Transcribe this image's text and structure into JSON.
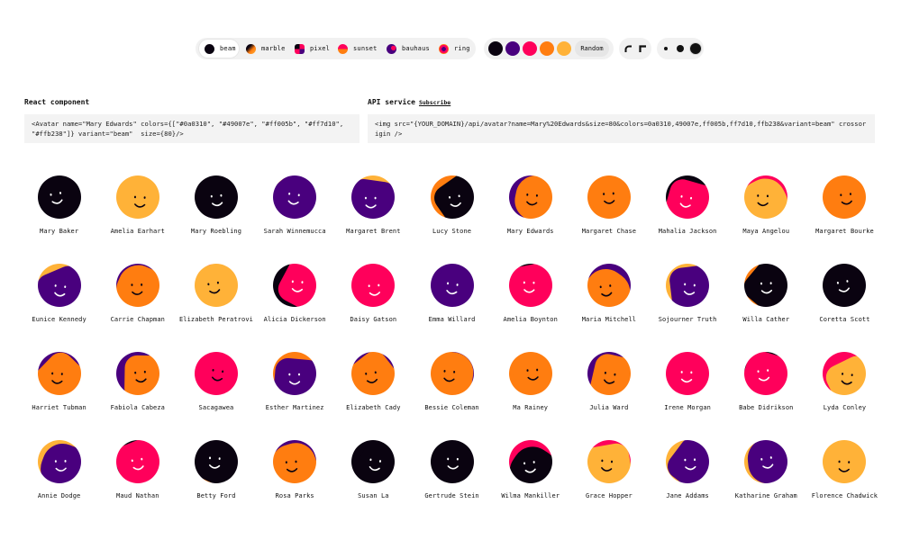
{
  "toolbar": {
    "variants": [
      {
        "label": "beam",
        "active": true,
        "icon": "beam-icon"
      },
      {
        "label": "marble",
        "active": false,
        "icon": "marble-icon"
      },
      {
        "label": "pixel",
        "active": false,
        "icon": "pixel-icon"
      },
      {
        "label": "sunset",
        "active": false,
        "icon": "sunset-icon"
      },
      {
        "label": "bauhaus",
        "active": false,
        "icon": "bauhaus-icon"
      },
      {
        "label": "ring",
        "active": false,
        "icon": "ring-icon"
      }
    ],
    "palette": [
      "#0a0310",
      "#49007e",
      "#ff005b",
      "#ff7d10",
      "#ffb238"
    ],
    "random_label": "Random",
    "shapes": [
      {
        "name": "round-shape-icon"
      },
      {
        "name": "square-shape-icon"
      }
    ],
    "sizes": [
      {
        "name": "size-small-button"
      },
      {
        "name": "size-medium-button"
      },
      {
        "name": "size-large-button"
      }
    ]
  },
  "code": {
    "react_label": "React component",
    "react_code": "<Avatar name=\"Mary Edwards\" colors={[\"#0a0310\", \"#49007e\", \"#ff005b\", \"#ff7d10\", \"#ffb238\"]} variant=\"beam\"  size={80}/>",
    "api_label": "API service",
    "subscribe_label": "Subscribe",
    "api_code": "<img src=\"{YOUR_DOMAIN}/api/avatar?name=Mary%20Edwards&size=80&colors=0a0310,49007e,ff005b,ff7d10,ffb238&variant=beam\" crossorigin />"
  },
  "avatars": [
    {
      "name": "Mary Baker",
      "bg": "#ff7d10",
      "face": "#0a0310",
      "eyes": "#ffffff"
    },
    {
      "name": "Amelia Earhart",
      "bg": "#ffb238",
      "face": "#ffb238",
      "eyes": "#0a0310"
    },
    {
      "name": "Mary Roebling",
      "bg": "#0a0310",
      "face": "#0a0310",
      "eyes": "#ffffff"
    },
    {
      "name": "Sarah Winnemucca",
      "bg": "#ffb238",
      "face": "#49007e",
      "eyes": "#ffffff"
    },
    {
      "name": "Margaret Brent",
      "bg": "#ffb238",
      "face": "#49007e",
      "eyes": "#ffffff"
    },
    {
      "name": "Lucy Stone",
      "bg": "#ff7d10",
      "face": "#0a0310",
      "eyes": "#ffffff"
    },
    {
      "name": "Mary Edwards",
      "bg": "#49007e",
      "face": "#ff7d10",
      "eyes": "#0a0310"
    },
    {
      "name": "Margaret Chase",
      "bg": "#ff7d10",
      "face": "#ff7d10",
      "eyes": "#0a0310"
    },
    {
      "name": "Mahalia Jackson",
      "bg": "#0a0310",
      "face": "#ff005b",
      "eyes": "#ffffff"
    },
    {
      "name": "Maya Angelou",
      "bg": "#ff005b",
      "face": "#ffb238",
      "eyes": "#0a0310"
    },
    {
      "name": "Margaret Bourke",
      "bg": "#ff7d10",
      "face": "#ff7d10",
      "eyes": "#0a0310"
    },
    {
      "name": "Eunice Kennedy",
      "bg": "#ffb238",
      "face": "#49007e",
      "eyes": "#ffffff"
    },
    {
      "name": "Carrie Chapman",
      "bg": "#49007e",
      "face": "#ff7d10",
      "eyes": "#0a0310"
    },
    {
      "name": "Elizabeth Peratrovich",
      "bg": "#ff005b",
      "face": "#ffb238",
      "eyes": "#0a0310"
    },
    {
      "name": "Alicia Dickerson",
      "bg": "#0a0310",
      "face": "#ff005b",
      "eyes": "#ffffff"
    },
    {
      "name": "Daisy Gatson",
      "bg": "#ff005b",
      "face": "#ff005b",
      "eyes": "#ffffff"
    },
    {
      "name": "Emma Willard",
      "bg": "#49007e",
      "face": "#49007e",
      "eyes": "#ffffff"
    },
    {
      "name": "Amelia Boynton",
      "bg": "#0a0310",
      "face": "#ff005b",
      "eyes": "#ffffff"
    },
    {
      "name": "Maria Mitchell",
      "bg": "#49007e",
      "face": "#ff7d10",
      "eyes": "#0a0310"
    },
    {
      "name": "Sojourner Truth",
      "bg": "#ffb238",
      "face": "#49007e",
      "eyes": "#ffffff"
    },
    {
      "name": "Willa Cather",
      "bg": "#ff7d10",
      "face": "#0a0310",
      "eyes": "#ffffff"
    },
    {
      "name": "Coretta Scott",
      "bg": "#0a0310",
      "face": "#0a0310",
      "eyes": "#ffffff"
    },
    {
      "name": "Harriet Tubman",
      "bg": "#49007e",
      "face": "#ff7d10",
      "eyes": "#0a0310"
    },
    {
      "name": "Fabiola Cabeza",
      "bg": "#49007e",
      "face": "#ff7d10",
      "eyes": "#0a0310"
    },
    {
      "name": "Sacagawea",
      "bg": "#ff005b",
      "face": "#ff005b",
      "eyes": "#0a0310"
    },
    {
      "name": "Esther Martinez",
      "bg": "#ff7d10",
      "face": "#49007e",
      "eyes": "#ffffff"
    },
    {
      "name": "Elizabeth Cady",
      "bg": "#49007e",
      "face": "#ff7d10",
      "eyes": "#0a0310"
    },
    {
      "name": "Bessie Coleman",
      "bg": "#49007e",
      "face": "#ff7d10",
      "eyes": "#0a0310"
    },
    {
      "name": "Ma Rainey",
      "bg": "#ff7d10",
      "face": "#ff7d10",
      "eyes": "#0a0310"
    },
    {
      "name": "Julia Ward",
      "bg": "#49007e",
      "face": "#ff7d10",
      "eyes": "#0a0310"
    },
    {
      "name": "Irene Morgan",
      "bg": "#ff005b",
      "face": "#ff005b",
      "eyes": "#ffffff"
    },
    {
      "name": "Babe Didrikson",
      "bg": "#0a0310",
      "face": "#ff005b",
      "eyes": "#ffffff"
    },
    {
      "name": "Lyda Conley",
      "bg": "#ff005b",
      "face": "#ffb238",
      "eyes": "#0a0310"
    },
    {
      "name": "Annie Dodge",
      "bg": "#ffb238",
      "face": "#49007e",
      "eyes": "#ffffff"
    },
    {
      "name": "Maud Nathan",
      "bg": "#0a0310",
      "face": "#ff005b",
      "eyes": "#ffffff"
    },
    {
      "name": "Betty Ford",
      "bg": "#ff7d10",
      "face": "#0a0310",
      "eyes": "#ffffff"
    },
    {
      "name": "Rosa Parks",
      "bg": "#49007e",
      "face": "#ff7d10",
      "eyes": "#0a0310"
    },
    {
      "name": "Susan La",
      "bg": "#0a0310",
      "face": "#0a0310",
      "eyes": "#ffffff"
    },
    {
      "name": "Gertrude Stein",
      "bg": "#0a0310",
      "face": "#0a0310",
      "eyes": "#ffffff"
    },
    {
      "name": "Wilma Mankiller",
      "bg": "#ff005b",
      "face": "#0a0310",
      "eyes": "#ffffff"
    },
    {
      "name": "Grace Hopper",
      "bg": "#ff005b",
      "face": "#ffb238",
      "eyes": "#0a0310"
    },
    {
      "name": "Jane Addams",
      "bg": "#ffb238",
      "face": "#49007e",
      "eyes": "#ffffff"
    },
    {
      "name": "Katharine Graham",
      "bg": "#ffb238",
      "face": "#49007e",
      "eyes": "#ffffff"
    },
    {
      "name": "Florence Chadwick",
      "bg": "#ffb238",
      "face": "#ffb238",
      "eyes": "#0a0310"
    }
  ]
}
